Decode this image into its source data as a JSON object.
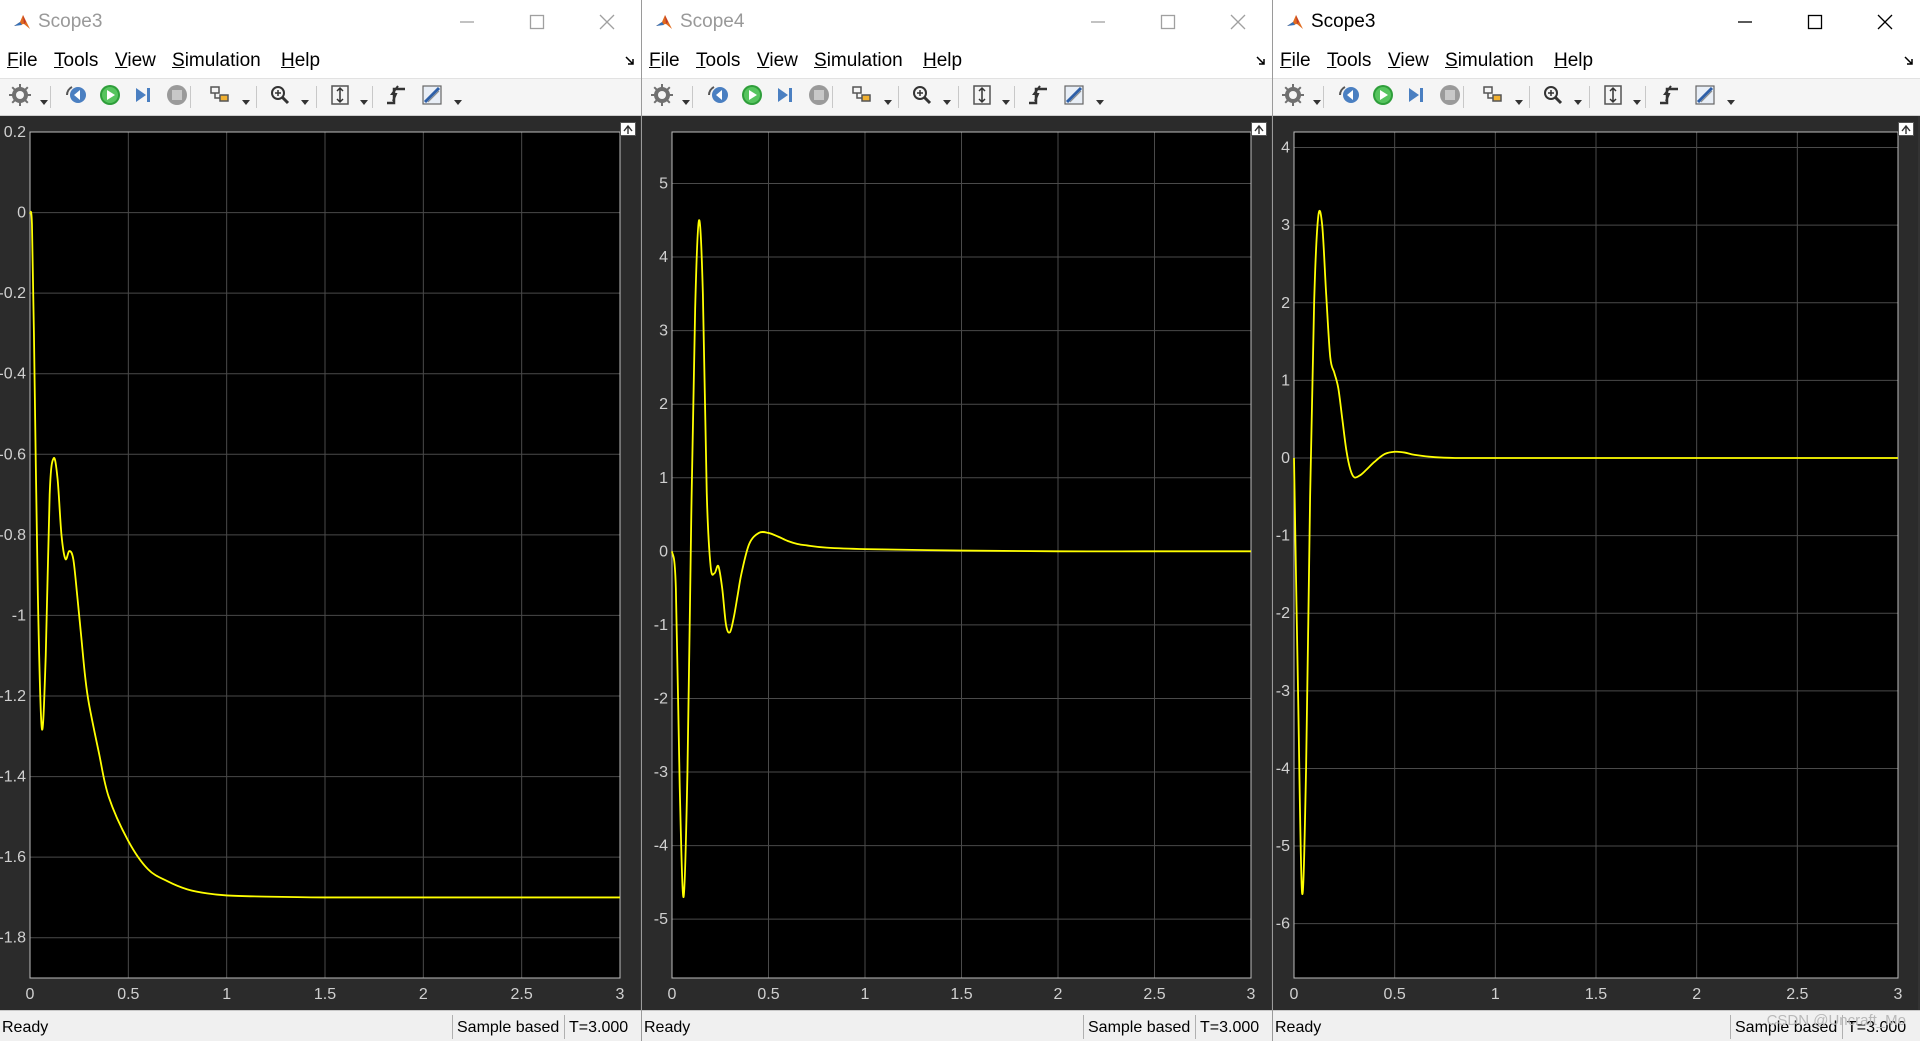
{
  "windows": [
    {
      "title": "Scope3",
      "active": false,
      "menu": [
        "File",
        "Tools",
        "View",
        "Simulation",
        "Help"
      ],
      "status": {
        "ready": "Ready",
        "sample_mode": "Sample based",
        "time": "T=3.000"
      },
      "chart_data": {
        "type": "line",
        "title": "",
        "xlabel": "",
        "ylabel": "",
        "xlim": [
          0,
          3
        ],
        "ylim": [
          -1.9,
          0.2
        ],
        "x_ticks": [
          0,
          0.5,
          1,
          1.5,
          2,
          2.5,
          3
        ],
        "y_ticks": [
          0.2,
          0,
          -0.2,
          -0.4,
          -0.6,
          -0.8,
          -1,
          -1.2,
          -1.4,
          -1.6,
          -1.8
        ],
        "grid": true,
        "line_color": "#ffff00",
        "background": "#000000",
        "series": [
          {
            "x": [
              0,
              0.01,
              0.02,
              0.04,
              0.06,
              0.08,
              0.1,
              0.12,
              0.14,
              0.16,
              0.18,
              0.2,
              0.22,
              0.24,
              0.26,
              0.28,
              0.3,
              0.35,
              0.4,
              0.5,
              0.6,
              0.7,
              0.8,
              0.9,
              1.0,
              1.2,
              1.5,
              2.0,
              2.5,
              3.0
            ],
            "y": [
              0,
              -0.03,
              -0.3,
              -0.95,
              -1.28,
              -1.1,
              -0.7,
              -0.61,
              -0.66,
              -0.8,
              -0.86,
              -0.84,
              -0.86,
              -0.95,
              -1.05,
              -1.15,
              -1.22,
              -1.34,
              -1.45,
              -1.56,
              -1.63,
              -1.66,
              -1.68,
              -1.69,
              -1.695,
              -1.698,
              -1.7,
              -1.7,
              -1.7,
              -1.7
            ]
          }
        ]
      }
    },
    {
      "title": "Scope4",
      "active": false,
      "menu": [
        "File",
        "Tools",
        "View",
        "Simulation",
        "Help"
      ],
      "status": {
        "ready": "Ready",
        "sample_mode": "Sample based",
        "time": "T=3.000"
      },
      "chart_data": {
        "type": "line",
        "title": "",
        "xlabel": "",
        "ylabel": "",
        "xlim": [
          0,
          3
        ],
        "ylim": [
          -5.8,
          5.7
        ],
        "x_ticks": [
          0,
          0.5,
          1,
          1.5,
          2,
          2.5,
          3
        ],
        "y_ticks": [
          5,
          4,
          3,
          2,
          1,
          0,
          -1,
          -2,
          -3,
          -4,
          -5
        ],
        "grid": true,
        "line_color": "#ffff00",
        "background": "#000000",
        "series": [
          {
            "x": [
              0,
              0.02,
              0.04,
              0.06,
              0.08,
              0.1,
              0.12,
              0.14,
              0.16,
              0.18,
              0.2,
              0.22,
              0.24,
              0.26,
              0.28,
              0.3,
              0.32,
              0.34,
              0.36,
              0.4,
              0.45,
              0.5,
              0.55,
              0.6,
              0.65,
              0.7,
              0.8,
              1.0,
              1.5,
              2.0,
              2.5,
              3.0
            ],
            "y": [
              0,
              -0.5,
              -3.2,
              -4.7,
              -3.0,
              0.5,
              3.3,
              4.5,
              3.5,
              0.8,
              -0.2,
              -0.3,
              -0.2,
              -0.5,
              -1.0,
              -1.1,
              -0.9,
              -0.6,
              -0.3,
              0.1,
              0.25,
              0.25,
              0.2,
              0.14,
              0.1,
              0.08,
              0.05,
              0.03,
              0.01,
              0.0,
              0.0,
              0.0
            ]
          }
        ]
      }
    },
    {
      "title": "Scope3",
      "active": true,
      "menu": [
        "File",
        "Tools",
        "View",
        "Simulation",
        "Help"
      ],
      "status": {
        "ready": "Ready",
        "sample_mode": "Sample based",
        "time": "T=3.000"
      },
      "chart_data": {
        "type": "line",
        "title": "",
        "xlabel": "",
        "ylabel": "",
        "xlim": [
          0,
          3
        ],
        "ylim": [
          -6.7,
          4.2
        ],
        "x_ticks": [
          0,
          0.5,
          1,
          1.5,
          2,
          2.5,
          3
        ],
        "y_ticks": [
          4,
          3,
          2,
          1,
          0,
          -1,
          -2,
          -3,
          -4,
          -5,
          -6
        ],
        "grid": true,
        "line_color": "#ffff00",
        "background": "#000000",
        "series": [
          {
            "x": [
              0,
              0.02,
              0.04,
              0.06,
              0.08,
              0.1,
              0.12,
              0.14,
              0.16,
              0.18,
              0.2,
              0.22,
              0.24,
              0.26,
              0.28,
              0.3,
              0.33,
              0.36,
              0.4,
              0.45,
              0.5,
              0.55,
              0.6,
              0.7,
              0.8,
              1.0,
              1.5,
              2.0,
              2.5,
              3.0
            ],
            "y": [
              0,
              -3.0,
              -5.6,
              -4.0,
              -0.5,
              2.0,
              3.1,
              3.0,
              2.1,
              1.3,
              1.1,
              0.9,
              0.5,
              0.1,
              -0.15,
              -0.25,
              -0.22,
              -0.15,
              -0.05,
              0.05,
              0.08,
              0.07,
              0.04,
              0.01,
              0.0,
              0.0,
              0.0,
              0.0,
              0.0,
              0.0
            ]
          }
        ]
      }
    }
  ],
  "toolbar_icons": [
    "settings-icon",
    "step-back-icon",
    "run-icon",
    "step-forward-icon",
    "stop-icon",
    "highlight-icon",
    "zoom-icon",
    "scale-axes-icon",
    "triggers-icon",
    "cursor-measure-icon"
  ],
  "watermark": "CSDN @Uncraft_Mo"
}
